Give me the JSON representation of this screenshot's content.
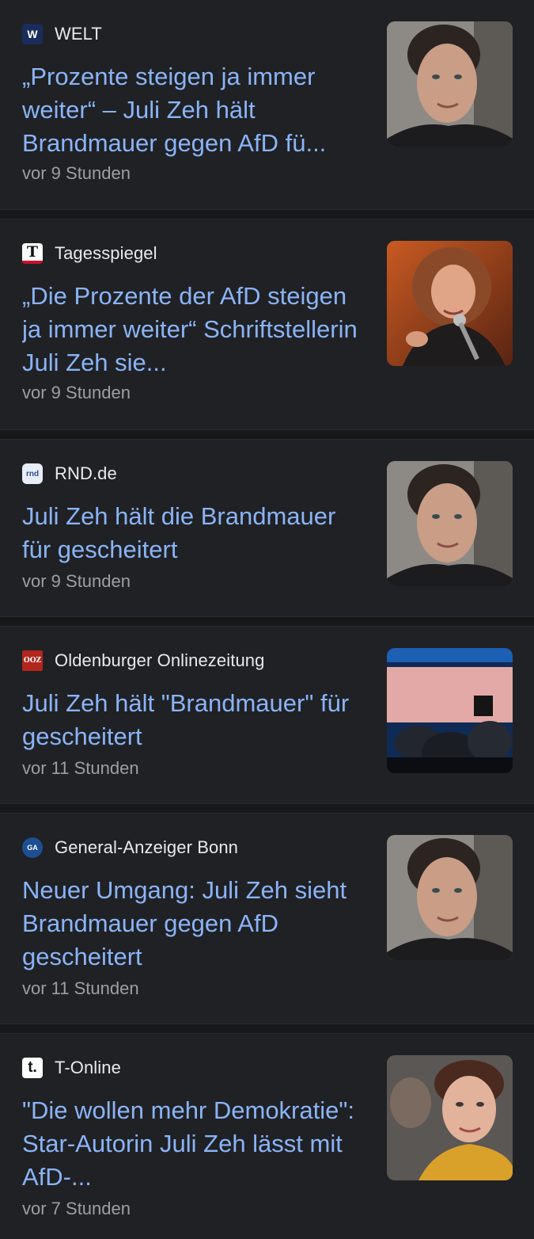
{
  "articles": [
    {
      "source": "WELT",
      "logo_text": "W",
      "logo_bg": "#1a2c5b",
      "logo_fg": "#ffffff",
      "headline": "„Prozente steigen ja immer weiter“ – Juli Zeh hält Brandmauer gegen AfD fü...",
      "time": "vor 9 Stunden",
      "thumb": "portrait-juli-zeh"
    },
    {
      "source": "Tagesspiegel",
      "logo_text": "T",
      "logo_bg": "#ffffff",
      "logo_fg": "#111111",
      "headline": "„Die Prozente der AfD steigen ja immer weiter“ Schriftstellerin Juli Zeh sie...",
      "time": "vor 9 Stunden",
      "thumb": "speaker-with-microphone"
    },
    {
      "source": "RND.de",
      "logo_text": "rnd",
      "logo_bg": "#e8eef7",
      "logo_fg": "#2c4f8f",
      "headline": "Juli Zeh hält die Brandmauer für gescheitert",
      "time": "vor 9 Stunden",
      "thumb": "portrait-juli-zeh"
    },
    {
      "source": "Oldenburger Onlinezeitung",
      "logo_text": "OOZ",
      "logo_bg": "#b3261e",
      "logo_fg": "#ffffff",
      "headline": "Juli Zeh hält \"Brandmauer\" für gescheitert",
      "time": "vor 11 Stunden",
      "thumb": "afd-party-event"
    },
    {
      "source": "General-Anzeiger Bonn",
      "logo_text": "GA",
      "logo_bg": "#1d4f91",
      "logo_fg": "#ffffff",
      "headline": "Neuer Umgang: Juli Zeh sieht Brandmauer gegen AfD gescheitert",
      "time": "vor 11 Stunden",
      "thumb": "portrait-juli-zeh"
    },
    {
      "source": "T-Online",
      "logo_text": "t.",
      "logo_bg": "#ffffff",
      "logo_fg": "#111111",
      "headline": "\"Die wollen mehr Demokratie\": Star-Autorin Juli Zeh lässt mit AfD-...",
      "time": "vor 7 Stunden",
      "thumb": "portrait-short-hair-yellow"
    }
  ],
  "colors": {
    "background": "#202124",
    "headline": "#8ab4f8",
    "source": "#e8eaed",
    "time": "#9aa0a6"
  }
}
